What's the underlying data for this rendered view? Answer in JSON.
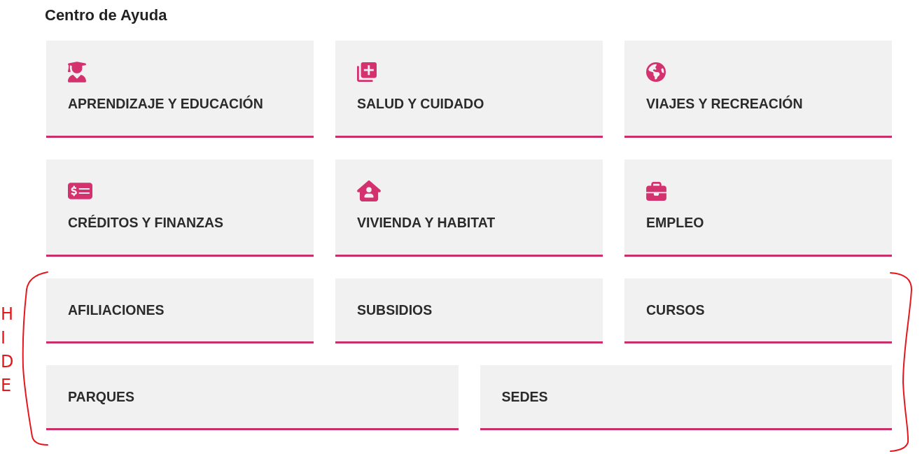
{
  "heading": "Centro de Ayuda",
  "tile_rows": [
    {
      "kind": "icon",
      "tiles": [
        "APRENDIZAJE Y EDUCACIÓN",
        "SALUD Y CUIDADO",
        "VIAJES Y RECREACIÓN"
      ]
    },
    {
      "kind": "icon",
      "tiles": [
        "CRÉDITOS Y FINANZAS",
        "VIVIENDA Y HABITAT",
        "EMPLEO"
      ]
    },
    {
      "kind": "plain",
      "tiles": [
        "AFILIACIONES",
        "SUBSIDIOS",
        "CURSOS"
      ]
    },
    {
      "kind": "plain",
      "tiles": [
        "PARQUES",
        "SEDES"
      ]
    }
  ],
  "annotation": {
    "text": "HIDE"
  }
}
